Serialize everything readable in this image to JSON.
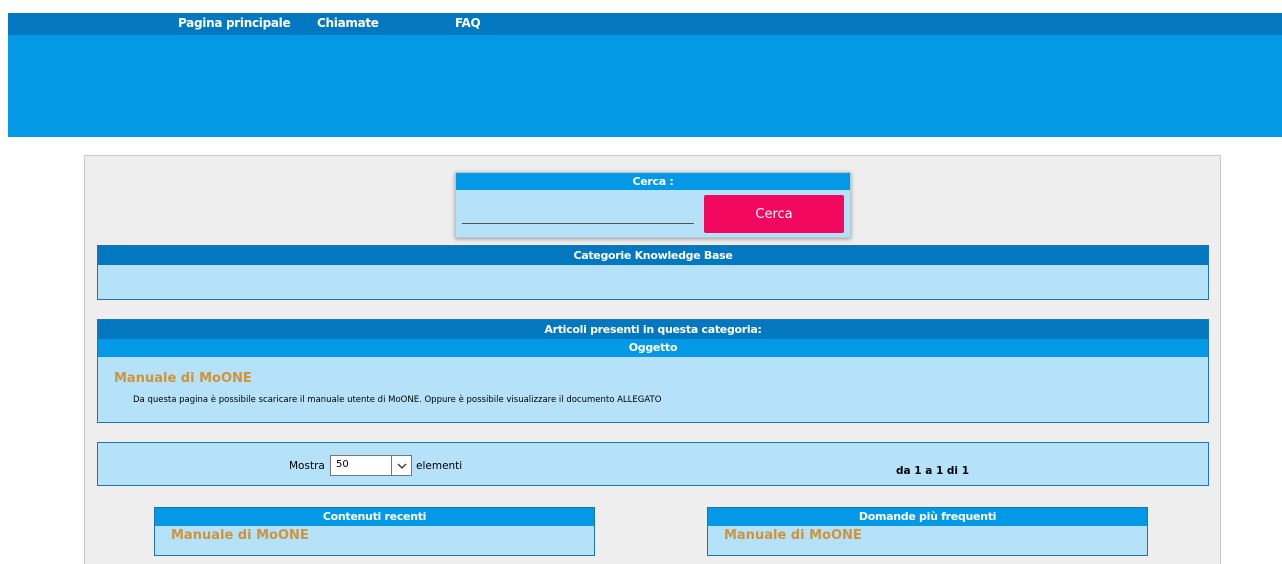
{
  "nav": {
    "home": "Pagina principale",
    "calls": "Chiamate",
    "faq": "FAQ"
  },
  "search": {
    "title": "Cerca :",
    "button": "Cerca",
    "value": ""
  },
  "categories": {
    "title": "Categorie Knowledge Base"
  },
  "articles": {
    "title": "Articoli presenti in questa categoria:",
    "column": "Oggetto",
    "items": [
      {
        "title": "Manuale di MoONE",
        "description": "Da questa pagina è possibile scaricare il manuale utente di MoONE. Oppure è possibile visualizzare il documento ALLEGATO"
      }
    ]
  },
  "pager": {
    "show_label": "Mostra",
    "selected": "50",
    "items_label": "elementi",
    "count": "da 1 a 1 di 1"
  },
  "recent": {
    "title": "Contenuti recenti",
    "item": "Manuale di MoONE"
  },
  "faq_box": {
    "title": "Domande più frequenti",
    "item": "Manuale di MoONE"
  },
  "colors": {
    "nav_dark": "#0377c0",
    "nav_light": "#0399e6",
    "panel_bg": "#b5e2f9",
    "accent_button": "#f2085f",
    "link": "#d0933a"
  }
}
